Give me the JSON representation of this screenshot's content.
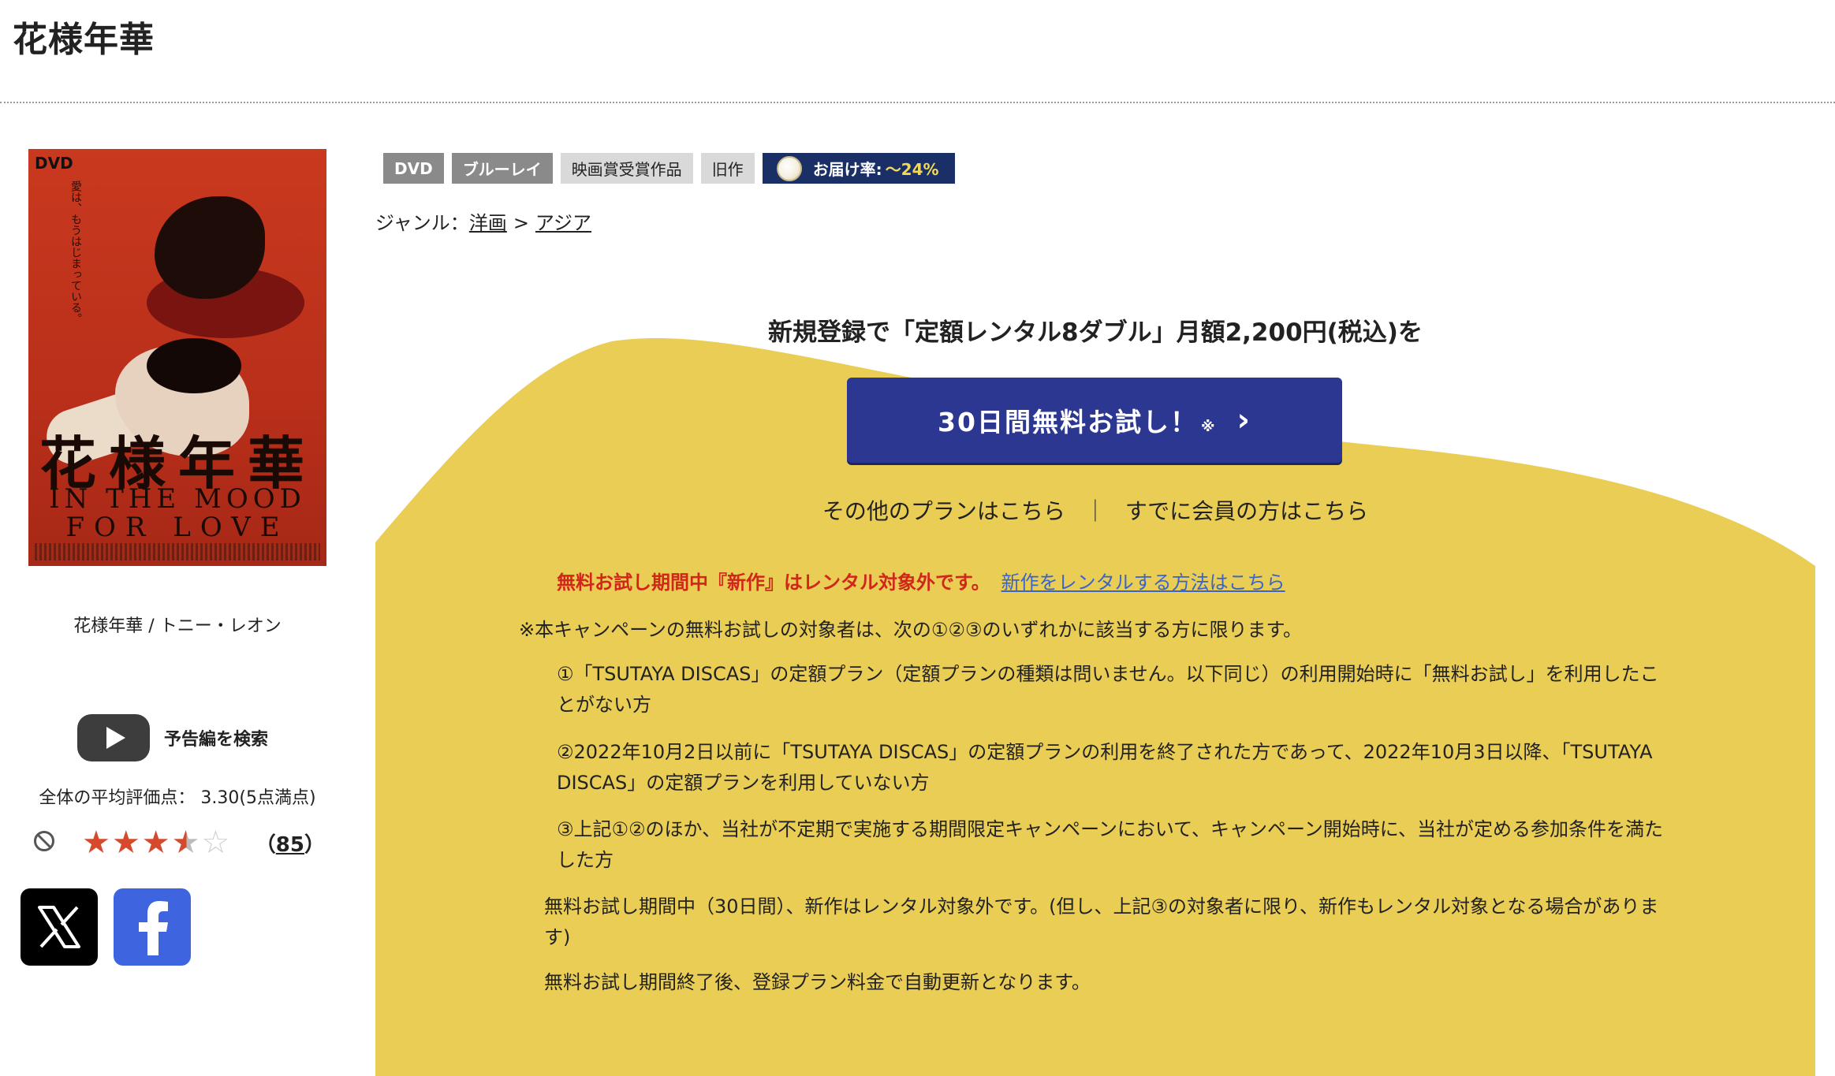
{
  "page": {
    "title": "花様年華"
  },
  "poster": {
    "dvd_logo": "DVD",
    "tagline": "愛は、もうはじまっている。",
    "title_jp": "花様年華",
    "title_en_line1": "IN THE MOOD",
    "title_en_line2": "FOR LOVE"
  },
  "work": {
    "subtitle": "花様年華 / トニー・レオン",
    "trailer_label": "予告編を検索",
    "average_rating_text": "全体の平均評価点： 3.30(5点満点)",
    "rating_value": 3.3,
    "rating_max": 5,
    "review_count_open": "（",
    "review_count": "85",
    "review_count_close": "）"
  },
  "share": {
    "x_icon": "x-logo-icon",
    "facebook_icon": "facebook-logo-icon"
  },
  "badges": {
    "dvd": "DVD",
    "bluray": "ブルーレイ",
    "award": "映画賞受賞作品",
    "old": "旧作",
    "delivery_label": "お届け率:",
    "delivery_rate": "～24%"
  },
  "genre": {
    "label": "ジャンル：",
    "level1": "洋画",
    "separator": ">",
    "level2": "アジア"
  },
  "campaign": {
    "headline": "新規登録で「定額レンタル8ダブル」月額2,200円(税込)を",
    "button_label": "30日間無料お試し！",
    "button_note": "※",
    "other_plans": "その他のプランはこちら",
    "divider": "｜",
    "member_link": "すでに会員の方はこちら",
    "notice_red": "無料お試し期間中『新作』はレンタル対象外です。",
    "notice_link": "新作をレンタルする方法はこちら",
    "conditions_intro": "※本キャンペーンの無料お試しの対象者は、次の①②③のいずれかに該当する方に限ります。",
    "condition1": "①「TSUTAYA DISCAS」の定額プラン（定額プランの種類は問いません。以下同じ）の利用開始時に「無料お試し」を利用したことがない方",
    "condition2": "②2022年10月2日以前に「TSUTAYA DISCAS」の定額プランの利用を終了された方であって、2022年10月3日以降、「TSUTAYA DISCAS」の定額プランを利用していない方",
    "condition3": "③上記①②のほか、当社が不定期で実施する期間限定キャンペーンにおいて、キャンペーン開始時に、当社が定める参加条件を満たした方",
    "paragraph1": "無料お試し期間中（30日間）、新作はレンタル対象外です。(但し、上記③の対象者に限り、新作もレンタル対象となる場合があります)",
    "paragraph2": "無料お試し期間終了後、登録プラン料金で自動更新となります。"
  },
  "colors": {
    "panel_yellow": "#e9cd55",
    "button_navy": "#2b3791",
    "badge_navy": "#1a2f66",
    "notice_red": "#d0271a",
    "link_blue": "#3b64c8",
    "star_red": "#d6492c"
  }
}
